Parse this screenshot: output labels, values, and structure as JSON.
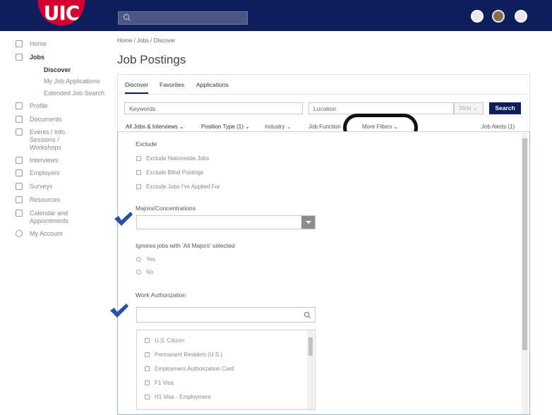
{
  "app": {
    "logo_text": "UIC",
    "colors": {
      "navy": "#0e1e5b",
      "brand_red": "#d50032",
      "check_blue": "#2e4fa8"
    }
  },
  "sidebar": {
    "items": [
      {
        "label": "Home",
        "icon": "home-icon"
      },
      {
        "label": "Jobs",
        "icon": "briefcase-icon"
      },
      {
        "label": "Profile",
        "icon": "person-icon"
      },
      {
        "label": "Documents",
        "icon": "document-icon"
      },
      {
        "label": "Events / Info Sessions / Workshops",
        "icon": "calendar-icon"
      },
      {
        "label": "Interviews",
        "icon": "people-icon"
      },
      {
        "label": "Employers",
        "icon": "building-icon"
      },
      {
        "label": "Surveys",
        "icon": "survey-icon"
      },
      {
        "label": "Resources",
        "icon": "resources-icon"
      },
      {
        "label": "Calendar and Appointments",
        "icon": "calendar-icon"
      },
      {
        "label": "My Account",
        "icon": "gear-icon"
      }
    ],
    "jobs_sub": [
      "Discover",
      "My Job Applications",
      "Extended Job Search"
    ]
  },
  "main": {
    "breadcrumb": "Home / Jobs / Discover",
    "title": "Job Postings",
    "tabs": [
      "Discover",
      "Favorites",
      "Applications"
    ],
    "keywords_placeholder": "Keywords",
    "location_placeholder": "Location",
    "miles": "25mi ⌄",
    "search_label": "Search",
    "filters": [
      "All Jobs & Interviews ⌄",
      "Position Type (1) ⌄",
      "Industry ⌄",
      "Job Function",
      "More Filters ⌄"
    ],
    "job_alerts": "Job Alerts (1)"
  },
  "more_filters": {
    "exclude_heading": "Exclude",
    "exclude_options": [
      "Exclude Nationwide Jobs",
      "Exclude Blind Postings",
      "Exclude Jobs I've Applied For"
    ],
    "majors_heading": "Majors/Concentrations",
    "ignores_heading": "Ignores jobs with 'All Majors' selected",
    "ignores_options": [
      "Yes",
      "No"
    ],
    "work_auth_heading": "Work Authorization",
    "work_auth_options": [
      "U.S. Citizen",
      "Permanent Resident (U.S.)",
      "Employment Authorization Card",
      "F1 Visa",
      "H1 Visa - Employment"
    ]
  }
}
